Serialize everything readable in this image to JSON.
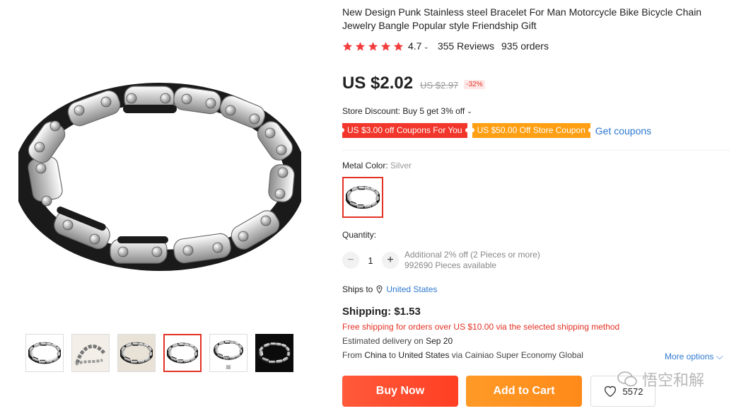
{
  "product": {
    "title": "New Design Punk Stainless steel Bracelet For Man Motorcycle Bike Bicycle Chain Jewelry Bangle Popular style Friendship Gift",
    "rating": "4.7",
    "reviews": "355 Reviews",
    "orders": "935 orders",
    "stars_filled": 5
  },
  "pricing": {
    "price": "US $2.02",
    "old_price": "US $2.97",
    "discount": "-32%"
  },
  "store": {
    "discount_text": "Store Discount: Buy 5 get 3% off",
    "coupon_1": "US $3.00 off Coupons For You",
    "coupon_2": "US $50.00 Off Store Coupon",
    "get_coupons": "Get coupons"
  },
  "variant": {
    "label": "Metal Color: ",
    "value": "Silver"
  },
  "quantity": {
    "label": "Quantity:",
    "minus": "−",
    "plus": "+",
    "value": "1",
    "note_1": "Additional 2% off (2 Pieces or more)",
    "note_2": "992690 Pieces available"
  },
  "shipping": {
    "ships_to_label": "Ships to",
    "country": "United States",
    "price": "Shipping: $1.53",
    "free_note": "Free shipping for orders over US $10.00 via the selected shipping method",
    "delivery_label": "Estimated delivery on",
    "delivery_date": "Sep 20",
    "from_prefix": "From",
    "from_country": "China",
    "to_word": "to",
    "to_country": "United States",
    "via": "via Cainiao Super Economy Global",
    "more_options": "More options"
  },
  "actions": {
    "buy_now": "Buy Now",
    "add_to_cart": "Add to Cart",
    "wishlist_count": "5572"
  },
  "gallery": {
    "thumb_count": 6,
    "active_index": 3
  },
  "watermark": {
    "text": "悟空和解"
  },
  "colors": {
    "accent": "#e43225",
    "buy_now": "#ff4b2b",
    "add_to_cart": "#ff9418",
    "link": "#2e79cf",
    "star": "#f23c3c"
  }
}
